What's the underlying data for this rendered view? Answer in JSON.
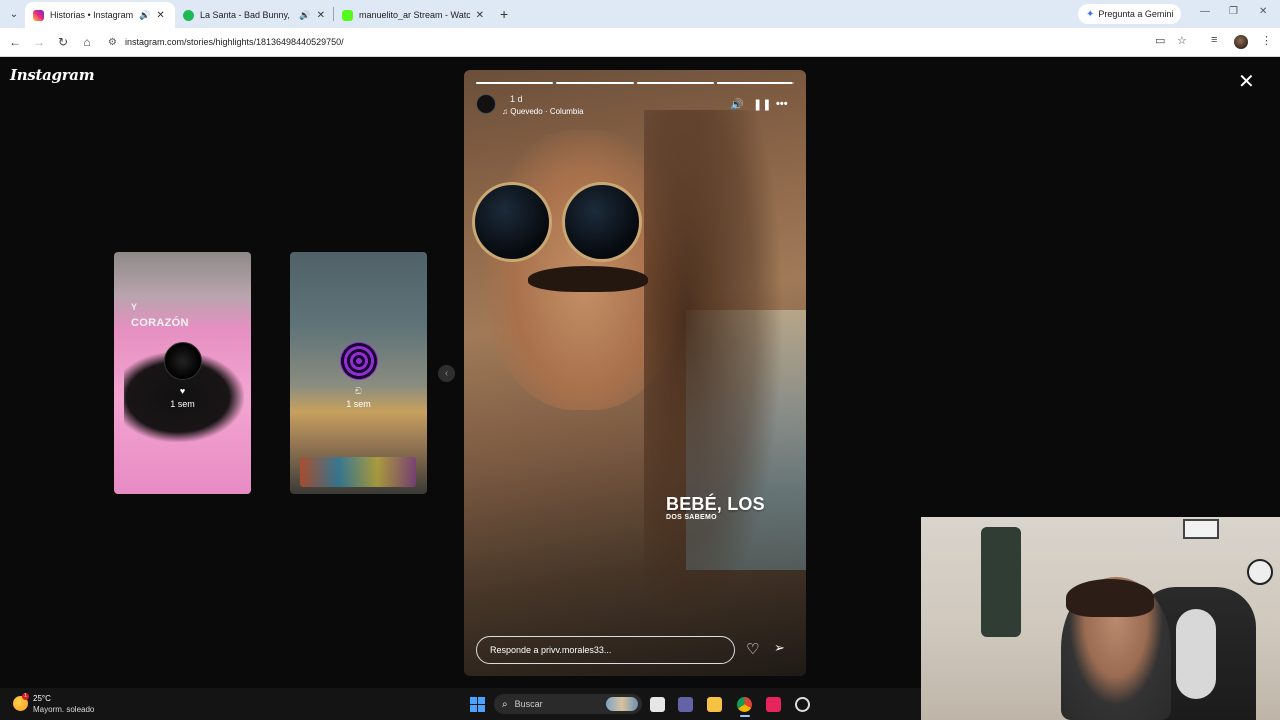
{
  "browser": {
    "tabs": [
      {
        "title": "Historias • Instagram",
        "active": true,
        "favicon_color": "#e1306c",
        "audio": true
      },
      {
        "title": "La Santa - Bad Bunny, Dadd",
        "active": false,
        "favicon_color": "#1db954",
        "audio": true
      },
      {
        "title": "manuelito_ar Stream - Watch L",
        "active": false,
        "favicon_color": "#53fc18",
        "audio": false
      }
    ],
    "gemini_label": "Pregunta a Gemini",
    "url": "instagram.com/stories/highlights/18136498440529750/"
  },
  "instagram": {
    "logo": "Instagram",
    "thumbnails": [
      {
        "overlay_small": "Y",
        "overlay_big": "CORAZÓN",
        "name": "♥",
        "time": "1 sem"
      },
      {
        "name": "ඞ",
        "time": "1 sem"
      }
    ],
    "story": {
      "progress": [
        1,
        1,
        1,
        0.98
      ],
      "time": "1 d",
      "music": "Quevedo · Columbia",
      "lyric_big": "BEBÉ, LOS",
      "lyric_small": "DOS SABEMO",
      "reply_placeholder": "Responde a privv.morales33..."
    }
  },
  "taskbar": {
    "weather_badge": "1",
    "temperature": "25°C",
    "weather": "Mayorm. soleado",
    "search_placeholder": "Buscar"
  },
  "colors": {
    "page_bg": "#0a0a0a",
    "tabbar_bg": "#dfe8f5",
    "accent_blue": "#4aa3ff"
  }
}
